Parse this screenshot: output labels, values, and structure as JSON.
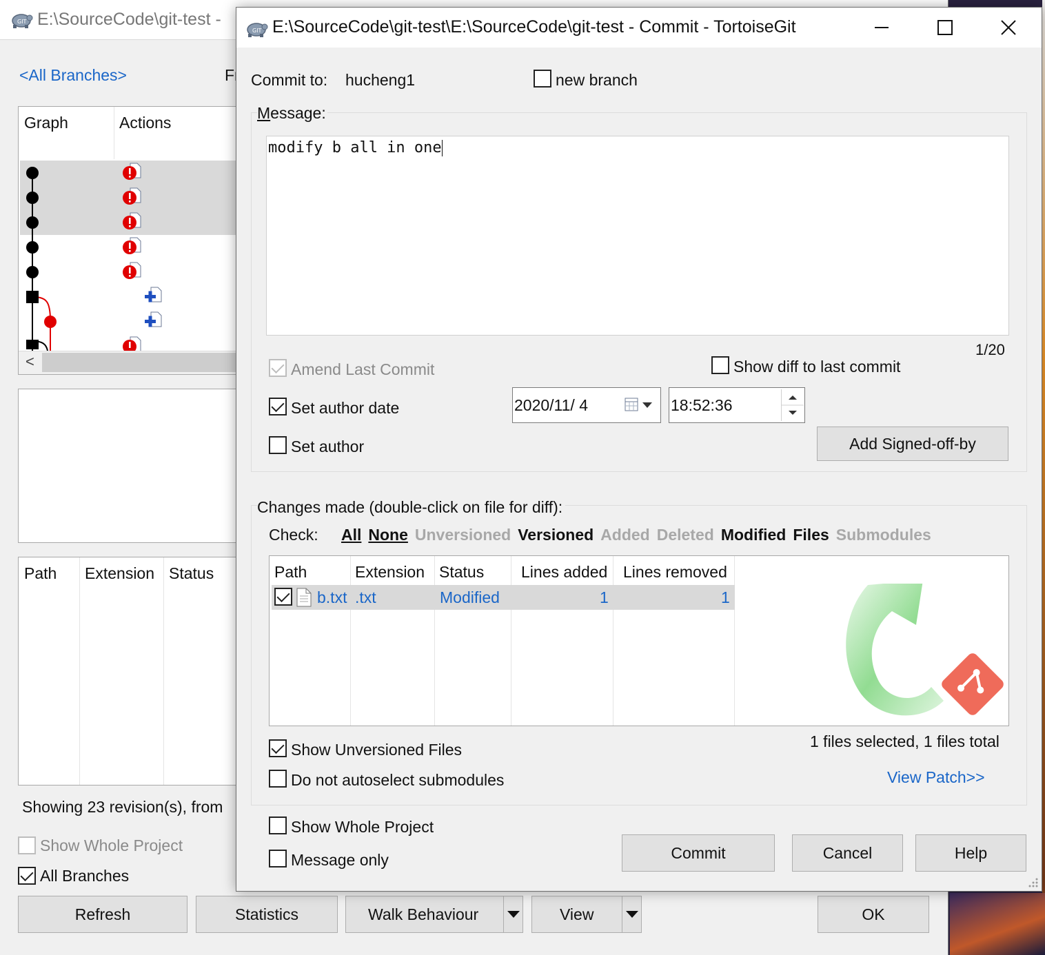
{
  "background_window": {
    "title": "E:\\SourceCode\\git-test - ",
    "branch_link": "<All Branches>",
    "from_label_partial": "Fr",
    "graph_columns": [
      "Graph",
      "Actions"
    ],
    "file_columns": [
      "Path",
      "Extension",
      "Status"
    ],
    "status_text": "Showing 23 revision(s), from",
    "show_whole_project": {
      "label": "Show Whole Project",
      "checked": false,
      "enabled": false
    },
    "all_branches": {
      "label": "All Branches",
      "checked": true
    },
    "buttons": {
      "refresh": "Refresh",
      "statistics": "Statistics",
      "walk_behaviour": "Walk Behaviour",
      "view": "View",
      "ok": "OK"
    }
  },
  "commit_window": {
    "title": "E:\\SourceCode\\git-test\\E:\\SourceCode\\git-test - Commit - TortoiseGit",
    "commit_to_label": "Commit to:",
    "branch": "hucheng1",
    "new_branch": {
      "label": "new branch",
      "checked": false
    },
    "message_label": "Message:",
    "message": "modify b all in one",
    "char_counter": "1/20",
    "amend_last_commit": {
      "label": "Amend Last Commit",
      "checked": true,
      "enabled": false
    },
    "show_diff_last_commit": {
      "label": "Show diff to last commit",
      "checked": false
    },
    "set_author_date": {
      "label": "Set author date",
      "checked": true
    },
    "date_value": "2020/11/ 4",
    "time_value": "18:52:36",
    "set_author": {
      "label": "Set author",
      "checked": false
    },
    "add_signed_off_by": "Add Signed-off-by",
    "changes_label": "Changes made (double-click on file for diff):",
    "check_label": "Check:",
    "check_filters": [
      {
        "label": "All",
        "active": true
      },
      {
        "label": "None",
        "active": true
      },
      {
        "label": "Unversioned",
        "active": false
      },
      {
        "label": "Versioned",
        "active": true
      },
      {
        "label": "Added",
        "active": false
      },
      {
        "label": "Deleted",
        "active": false
      },
      {
        "label": "Modified",
        "active": true
      },
      {
        "label": "Files",
        "active": true
      },
      {
        "label": "Submodules",
        "active": false
      }
    ],
    "file_list": {
      "columns": [
        "Path",
        "Extension",
        "Status",
        "Lines added",
        "Lines removed"
      ],
      "rows": [
        {
          "path": "b.txt",
          "extension": ".txt",
          "status": "Modified",
          "lines_added": "1",
          "lines_removed": "1",
          "checked": true
        }
      ]
    },
    "selection_summary": "1 files selected, 1 files total",
    "show_unversioned_files": {
      "label": "Show Unversioned Files",
      "checked": true
    },
    "do_not_autoselect_submodules": {
      "label": "Do not autoselect submodules",
      "checked": false
    },
    "view_patch": "View Patch>>",
    "show_whole_project": {
      "label": "Show Whole Project",
      "checked": false
    },
    "message_only": {
      "label": "Message only",
      "checked": false
    },
    "buttons": {
      "commit": "Commit",
      "cancel": "Cancel",
      "help": "Help"
    }
  },
  "colors": {
    "link": "#1a66c8",
    "window_bg": "#f0f0f0",
    "selection_row": "#d9d9d9",
    "graph_red": "#e00000",
    "logo_green": "#7fd67f",
    "logo_red": "#ef6b5a"
  }
}
